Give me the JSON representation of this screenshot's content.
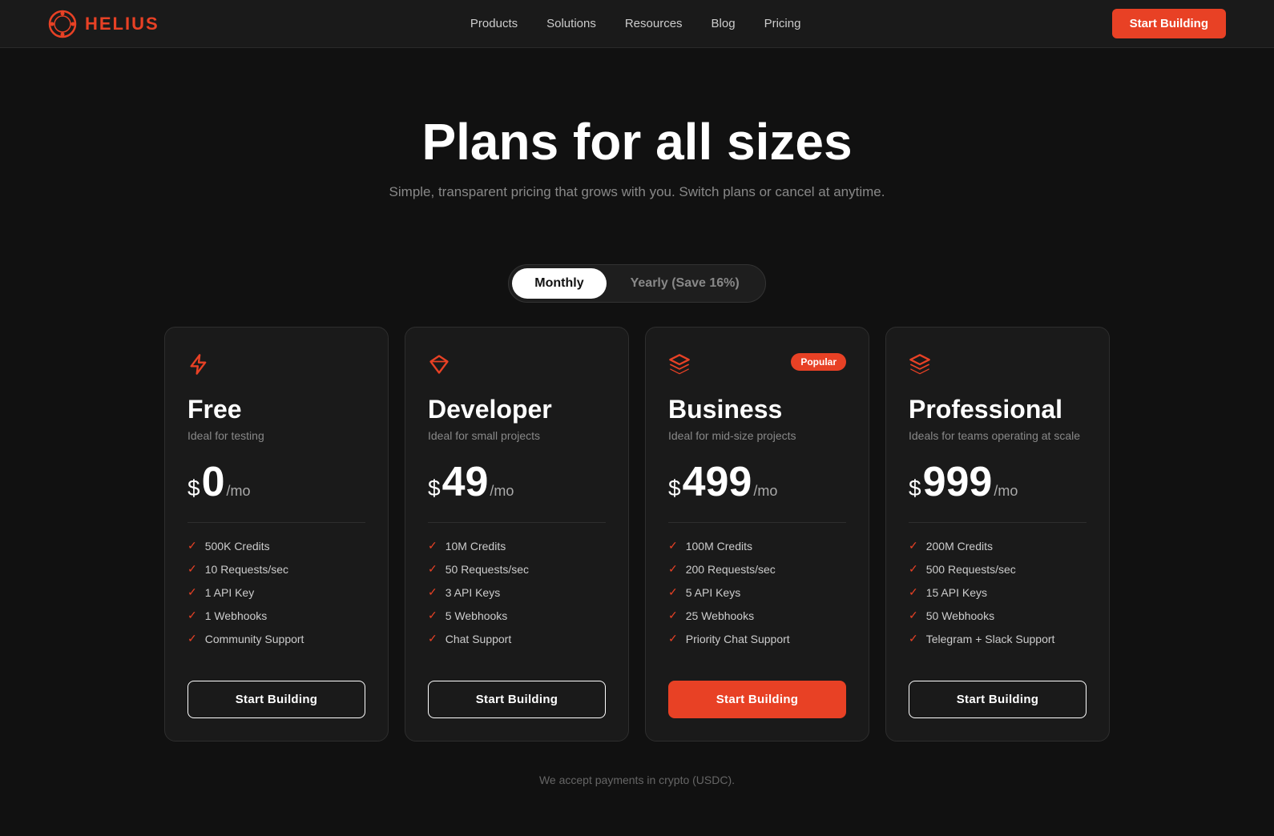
{
  "nav": {
    "logo_text": "HELIUS",
    "links": [
      "Products",
      "Solutions",
      "Resources",
      "Blog",
      "Pricing"
    ],
    "cta_label": "Start Building"
  },
  "hero": {
    "title": "Plans for all sizes",
    "subtitle": "Simple, transparent pricing that grows with you. Switch plans or cancel at anytime."
  },
  "billing_toggle": {
    "monthly_label": "Monthly",
    "yearly_label": "Yearly (Save 16%)"
  },
  "plans": [
    {
      "id": "free",
      "icon": "lightning",
      "title": "Free",
      "subtitle": "Ideal for testing",
      "price": "0",
      "period": "/mo",
      "dollar_sign": "$ ",
      "popular": false,
      "features": [
        "500K Credits",
        "10 Requests/sec",
        "1 API Key",
        "1 Webhooks",
        "Community Support"
      ],
      "cta_label": "Start Building",
      "cta_primary": false
    },
    {
      "id": "developer",
      "icon": "diamond",
      "title": "Developer",
      "subtitle": "Ideal for small projects",
      "price": "49",
      "period": "/mo",
      "dollar_sign": "$ ",
      "popular": false,
      "features": [
        "10M Credits",
        "50 Requests/sec",
        "3 API Keys",
        "5 Webhooks",
        "Chat Support"
      ],
      "cta_label": "Start Building",
      "cta_primary": false
    },
    {
      "id": "business",
      "icon": "layers",
      "title": "Business",
      "subtitle": "Ideal for mid-size projects",
      "price": "499",
      "period": "/mo",
      "dollar_sign": "$",
      "popular": true,
      "popular_label": "Popular",
      "features": [
        "100M Credits",
        "200 Requests/sec",
        "5 API Keys",
        "25 Webhooks",
        "Priority Chat Support"
      ],
      "cta_label": "Start Building",
      "cta_primary": true
    },
    {
      "id": "professional",
      "icon": "layers2",
      "title": "Professional",
      "subtitle": "Ideals for teams operating at scale",
      "price": "999",
      "period": "/mo",
      "dollar_sign": "$",
      "popular": false,
      "features": [
        "200M Credits",
        "500 Requests/sec",
        "15 API Keys",
        "50 Webhooks",
        "Telegram + Slack  Support"
      ],
      "cta_label": "Start Building",
      "cta_primary": false
    }
  ],
  "footer": {
    "note": "We accept payments in crypto (USDC)."
  }
}
